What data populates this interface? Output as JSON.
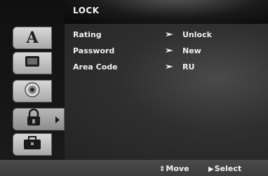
{
  "menu": {
    "title": "LOCK",
    "rows": [
      {
        "label": "Rating",
        "value": "Unlock"
      },
      {
        "label": "Password",
        "value": "New"
      },
      {
        "label": "Area Code",
        "value": "RU"
      }
    ]
  },
  "tabs": [
    {
      "icon": "letter-a-icon",
      "glyph": "A"
    },
    {
      "icon": "monitor-icon"
    },
    {
      "icon": "speaker-icon"
    },
    {
      "icon": "lock-icon"
    },
    {
      "icon": "briefcase-icon"
    }
  ],
  "bottom": {
    "move_glyph": "⇕",
    "move_label": "Move",
    "select_glyph": "▶",
    "select_label": "Select"
  }
}
